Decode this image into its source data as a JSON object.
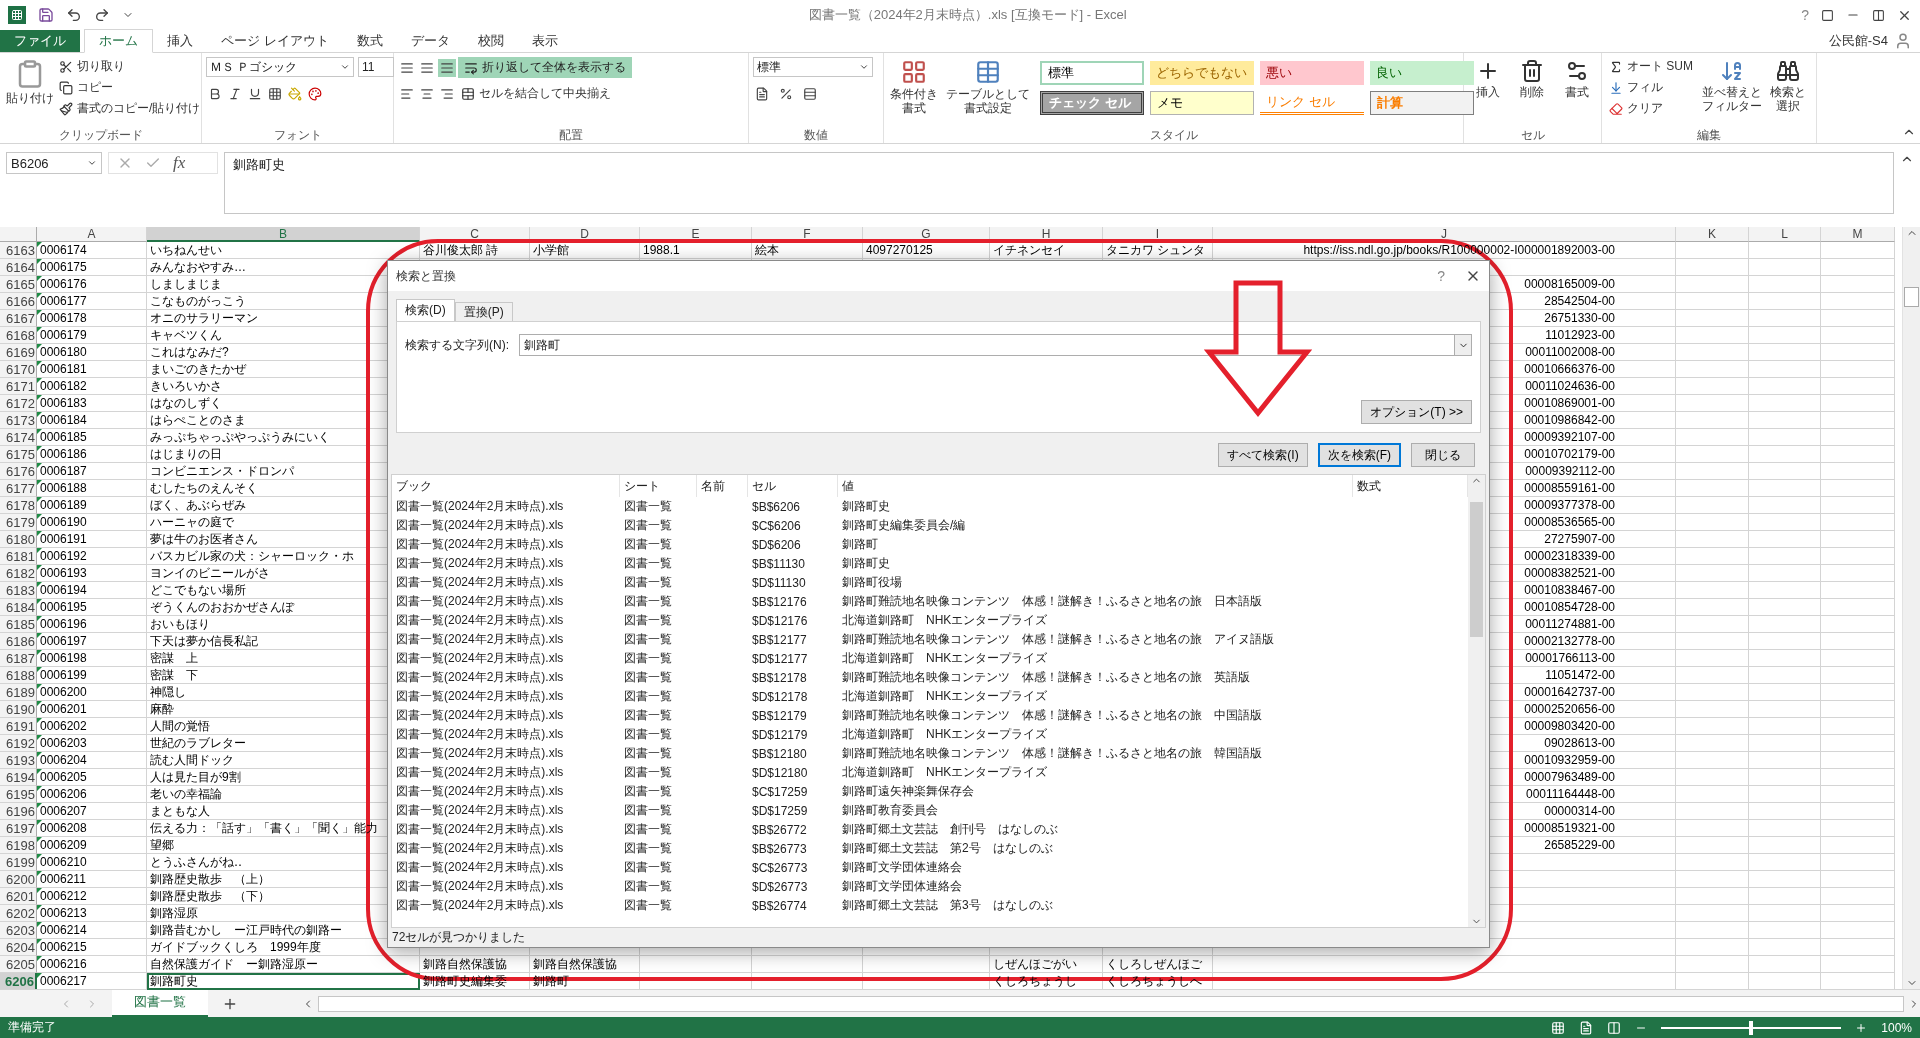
{
  "window": {
    "title": "図書一覧（2024年2月末時点）.xls  [互換モード] - Excel",
    "help": "?",
    "account": "公民館-S4"
  },
  "ribbon": {
    "tabs": [
      {
        "label": "ファイル",
        "kind": "file",
        "selected": false
      },
      {
        "label": "ホーム",
        "kind": "tab",
        "selected": true
      },
      {
        "label": "挿入",
        "kind": "tab",
        "selected": false
      },
      {
        "label": "ページ レイアウト",
        "kind": "tab",
        "selected": false
      },
      {
        "label": "数式",
        "kind": "tab",
        "selected": false
      },
      {
        "label": "データ",
        "kind": "tab",
        "selected": false
      },
      {
        "label": "校閲",
        "kind": "tab",
        "selected": false
      },
      {
        "label": "表示",
        "kind": "tab",
        "selected": false
      }
    ],
    "clipboard": {
      "label": "クリップボード",
      "paste": "貼り付け",
      "cut": "切り取り",
      "copy": "コピー",
      "format_painter": "書式のコピー/貼り付け"
    },
    "font": {
      "label": "フォント",
      "name": "ＭＳ Ｐゴシック",
      "size": "11"
    },
    "alignment": {
      "label": "配置",
      "wrap_text": {
        "label": "折り返して全体を表示する",
        "selected": true
      },
      "merge": "セルを結合して中央揃え"
    },
    "number": {
      "label": "数値",
      "format": "標準"
    },
    "styles": {
      "label": "スタイル",
      "conditional": [
        "条件付き",
        "書式"
      ],
      "table": [
        "テーブルとして",
        "書式設定"
      ],
      "gallery": [
        {
          "label": "標準",
          "kind": "normal"
        },
        {
          "label": "どちらでもない",
          "kind": "neutral"
        },
        {
          "label": "悪い",
          "kind": "bad"
        },
        {
          "label": "良い",
          "kind": "good"
        },
        {
          "label": "チェック セル",
          "kind": "check"
        },
        {
          "label": "メモ",
          "kind": "note"
        },
        {
          "label": "リンク セル",
          "kind": "link"
        },
        {
          "label": "計算",
          "kind": "calc"
        }
      ]
    },
    "cells": {
      "label": "セル",
      "insert": "挿入",
      "delete": "削除",
      "format": "書式"
    },
    "editing": {
      "label": "編集",
      "autosum": "オート SUM",
      "fill": "フィル",
      "clear": "クリア",
      "sort": [
        "並べ替えと",
        "フィルター"
      ],
      "find": [
        "検索と",
        "選択"
      ]
    }
  },
  "formula_bar": {
    "name_box": "B6206",
    "fx": "fx",
    "value": "釧路町史"
  },
  "sheet": {
    "columns": [
      {
        "label": "A",
        "selected": false
      },
      {
        "label": "B",
        "selected": true
      },
      {
        "label": "C",
        "selected": false
      },
      {
        "label": "D",
        "selected": false
      },
      {
        "label": "E",
        "selected": false
      },
      {
        "label": "F",
        "selected": false
      },
      {
        "label": "G",
        "selected": false
      },
      {
        "label": "H",
        "selected": false
      },
      {
        "label": "I",
        "selected": false
      },
      {
        "label": "J",
        "selected": false
      },
      {
        "label": "K",
        "selected": false
      },
      {
        "label": "L",
        "selected": false
      },
      {
        "label": "M",
        "selected": false
      }
    ],
    "rows": [
      {
        "number": "6163",
        "selected": false,
        "cells": {
          "A": "0006174",
          "B": "いちねんせい",
          "C": "谷川俊太郎 詩",
          "D": "小学館",
          "E": "1988.1",
          "F": "絵本",
          "G": "4097270125",
          "H": "イチネンセイ",
          "I": "タニカワ シュンタ",
          "J": "https://iss.ndl.go.jp/books/R100000002-I000001892003-00"
        }
      },
      {
        "number": "6164",
        "selected": false,
        "cells": {
          "A": "0006175",
          "B": "みんなおやすみ…"
        }
      },
      {
        "number": "6165",
        "selected": false,
        "cells": {
          "A": "0006176",
          "B": "しましまじま",
          "J": "00008165009-00"
        }
      },
      {
        "number": "6166",
        "selected": false,
        "cells": {
          "A": "0006177",
          "B": "こなものがっこう",
          "J": "28542504-00"
        }
      },
      {
        "number": "6167",
        "selected": false,
        "cells": {
          "A": "0006178",
          "B": "オニのサラリーマン",
          "J": "26751330-00"
        }
      },
      {
        "number": "6168",
        "selected": false,
        "cells": {
          "A": "0006179",
          "B": "キャベツくん",
          "J": "11012923-00"
        }
      },
      {
        "number": "6169",
        "selected": false,
        "cells": {
          "A": "0006180",
          "B": "これはなみだ?",
          "J": "00011002008-00"
        }
      },
      {
        "number": "6170",
        "selected": false,
        "cells": {
          "A": "0006181",
          "B": "まいごのきたかぜ",
          "J": "00010666376-00"
        }
      },
      {
        "number": "6171",
        "selected": false,
        "cells": {
          "A": "0006182",
          "B": "きいろいかさ",
          "J": "00011024636-00"
        }
      },
      {
        "number": "6172",
        "selected": false,
        "cells": {
          "A": "0006183",
          "B": "はなのしずく",
          "J": "00010869001-00"
        }
      },
      {
        "number": "6173",
        "selected": false,
        "cells": {
          "A": "0006184",
          "B": "はらぺことのさま",
          "J": "00010986842-00"
        }
      },
      {
        "number": "6174",
        "selected": false,
        "cells": {
          "A": "0006185",
          "B": "みっぷちゃっぷやっぷうみにいく",
          "J": "00009392107-00"
        }
      },
      {
        "number": "6175",
        "selected": false,
        "cells": {
          "A": "0006186",
          "B": "はじまりの日",
          "J": "00010702179-00"
        }
      },
      {
        "number": "6176",
        "selected": false,
        "cells": {
          "A": "0006187",
          "B": "コンビニエンス・ドロンパ",
          "J": "00009392112-00"
        }
      },
      {
        "number": "6177",
        "selected": false,
        "cells": {
          "A": "0006188",
          "B": "むしたちのえんそく",
          "J": "00008559161-00"
        }
      },
      {
        "number": "6178",
        "selected": false,
        "cells": {
          "A": "0006189",
          "B": "ぼく、あぶらぜみ",
          "J": "00009377378-00"
        }
      },
      {
        "number": "6179",
        "selected": false,
        "cells": {
          "A": "0006190",
          "B": "ハーニャの庭で",
          "J": "00008536565-00"
        }
      },
      {
        "number": "6180",
        "selected": false,
        "cells": {
          "A": "0006191",
          "B": "夢は牛のお医者さん",
          "J": "27275907-00"
        }
      },
      {
        "number": "6181",
        "selected": false,
        "cells": {
          "A": "0006192",
          "B": "バスカビル家の犬：シャーロック・ホ",
          "J": "00002318339-00"
        }
      },
      {
        "number": "6182",
        "selected": false,
        "cells": {
          "A": "0006193",
          "B": "ヨンイのビニールがさ",
          "J": "00008382521-00"
        }
      },
      {
        "number": "6183",
        "selected": false,
        "cells": {
          "A": "0006194",
          "B": "どこでもない場所",
          "J": "00010838467-00"
        }
      },
      {
        "number": "6184",
        "selected": false,
        "cells": {
          "A": "0006195",
          "B": "ぞうくんのおおかぜさんぽ",
          "J": "00010854728-00"
        }
      },
      {
        "number": "6185",
        "selected": false,
        "cells": {
          "A": "0006196",
          "B": "おいもほり",
          "J": "00011274881-00"
        }
      },
      {
        "number": "6186",
        "selected": false,
        "cells": {
          "A": "0006197",
          "B": "下天は夢か信長私記",
          "J": "00002132778-00"
        }
      },
      {
        "number": "6187",
        "selected": false,
        "cells": {
          "A": "0006198",
          "B": "密謀　上",
          "J": "00001766113-00"
        }
      },
      {
        "number": "6188",
        "selected": false,
        "cells": {
          "A": "0006199",
          "B": "密謀　下",
          "J": "11051472-00"
        }
      },
      {
        "number": "6189",
        "selected": false,
        "cells": {
          "A": "0006200",
          "B": "神隠し",
          "J": "00001642737-00"
        }
      },
      {
        "number": "6190",
        "selected": false,
        "cells": {
          "A": "0006201",
          "B": "麻酔",
          "J": "00002520656-00"
        }
      },
      {
        "number": "6191",
        "selected": false,
        "cells": {
          "A": "0006202",
          "B": "人間の覚悟",
          "J": "00009803420-00"
        }
      },
      {
        "number": "6192",
        "selected": false,
        "cells": {
          "A": "0006203",
          "B": "世紀のラブレター",
          "J": "09028613-00"
        }
      },
      {
        "number": "6193",
        "selected": false,
        "cells": {
          "A": "0006204",
          "B": "読む人間ドック",
          "J": "00010932959-00"
        }
      },
      {
        "number": "6194",
        "selected": false,
        "cells": {
          "A": "0006205",
          "B": "人は見た目が9割",
          "J": "00007963489-00"
        }
      },
      {
        "number": "6195",
        "selected": false,
        "cells": {
          "A": "0006206",
          "B": "老いの幸福論",
          "J": "00011164448-00"
        }
      },
      {
        "number": "6196",
        "selected": false,
        "cells": {
          "A": "0006207",
          "B": "まともな人",
          "J": "00000314-00"
        }
      },
      {
        "number": "6197",
        "selected": false,
        "cells": {
          "A": "0006208",
          "B": "伝える力：「話す」「書く」「聞く」能力",
          "J": "00008519321-00"
        }
      },
      {
        "number": "6198",
        "selected": false,
        "cells": {
          "A": "0006209",
          "B": "望郷",
          "J": "26585229-00"
        }
      },
      {
        "number": "6199",
        "selected": false,
        "cells": {
          "A": "0006210",
          "B": "とうふさんがね‥"
        }
      },
      {
        "number": "6200",
        "selected": false,
        "cells": {
          "A": "0006211",
          "B": "釧路歴史散歩　（上）"
        }
      },
      {
        "number": "6201",
        "selected": false,
        "cells": {
          "A": "0006212",
          "B": "釧路歴史散歩　（下）"
        }
      },
      {
        "number": "6202",
        "selected": false,
        "cells": {
          "A": "0006213",
          "B": "釧路湿原"
        }
      },
      {
        "number": "6203",
        "selected": false,
        "cells": {
          "A": "0006214",
          "B": "釧路昔むかし　ー江戸時代の釧路ー"
        }
      },
      {
        "number": "6204",
        "selected": false,
        "cells": {
          "A": "0006215",
          "B": "ガイドブックくしろ　1999年度"
        }
      },
      {
        "number": "6205",
        "selected": false,
        "cells": {
          "A": "0006216",
          "B": "自然保護ガイド　ー釧路湿原ー",
          "C": "釧路自然保護協",
          "D": "釧路自然保護協",
          "H": "しぜんほごがい",
          "I": "くしろしぜんほご"
        }
      },
      {
        "number": "6206",
        "selected": true,
        "cells": {
          "A": "0006217",
          "B": "釧路町史",
          "C": "釧路町史編集委",
          "D": "釧路町",
          "H": "くしろちょうし",
          "I": "くしろちょうしへ"
        }
      }
    ]
  },
  "dialog": {
    "title": "検索と置換",
    "help": "?",
    "tabs": [
      {
        "label": "検索(D)",
        "selected": true
      },
      {
        "label": "置換(P)",
        "selected": false
      }
    ],
    "search_label": "検索する文字列(N):",
    "search_value": "釧路町",
    "options_button": "オプション(T) >>",
    "buttons": [
      {
        "label": "すべて検索(I)",
        "selected": false
      },
      {
        "label": "次を検索(F)",
        "selected": true
      },
      {
        "label": "閉じる",
        "selected": false
      }
    ],
    "results": {
      "columns": [
        "ブック",
        "シート",
        "名前",
        "セル",
        "値",
        "数式"
      ],
      "rows": [
        {
          "book": "図書一覧(2024年2月末時点).xls",
          "sheet": "図書一覧",
          "cell": "$B$6206",
          "value": "釧路町史"
        },
        {
          "book": "図書一覧(2024年2月末時点).xls",
          "sheet": "図書一覧",
          "cell": "$C$6206",
          "value": "釧路町史編集委員会/編"
        },
        {
          "book": "図書一覧(2024年2月末時点).xls",
          "sheet": "図書一覧",
          "cell": "$D$6206",
          "value": "釧路町"
        },
        {
          "book": "図書一覧(2024年2月末時点).xls",
          "sheet": "図書一覧",
          "cell": "$B$11130",
          "value": "釧路町史"
        },
        {
          "book": "図書一覧(2024年2月末時点).xls",
          "sheet": "図書一覧",
          "cell": "$D$11130",
          "value": "釧路町役場"
        },
        {
          "book": "図書一覧(2024年2月末時点).xls",
          "sheet": "図書一覧",
          "cell": "$B$12176",
          "value": "釧路町難読地名映像コンテンツ　体感！謎解き！ふるさと地名の旅　日本語版"
        },
        {
          "book": "図書一覧(2024年2月末時点).xls",
          "sheet": "図書一覧",
          "cell": "$D$12176",
          "value": "北海道釧路町　NHKエンタープライズ"
        },
        {
          "book": "図書一覧(2024年2月末時点).xls",
          "sheet": "図書一覧",
          "cell": "$B$12177",
          "value": "釧路町難読地名映像コンテンツ　体感！謎解き！ふるさと地名の旅　アイヌ語版"
        },
        {
          "book": "図書一覧(2024年2月末時点).xls",
          "sheet": "図書一覧",
          "cell": "$D$12177",
          "value": "北海道釧路町　NHKエンタープライズ"
        },
        {
          "book": "図書一覧(2024年2月末時点).xls",
          "sheet": "図書一覧",
          "cell": "$B$12178",
          "value": "釧路町難読地名映像コンテンツ　体感！謎解き！ふるさと地名の旅　英語版"
        },
        {
          "book": "図書一覧(2024年2月末時点).xls",
          "sheet": "図書一覧",
          "cell": "$D$12178",
          "value": "北海道釧路町　NHKエンタープライズ"
        },
        {
          "book": "図書一覧(2024年2月末時点).xls",
          "sheet": "図書一覧",
          "cell": "$B$12179",
          "value": "釧路町難読地名映像コンテンツ　体感！謎解き！ふるさと地名の旅　中国語版"
        },
        {
          "book": "図書一覧(2024年2月末時点).xls",
          "sheet": "図書一覧",
          "cell": "$D$12179",
          "value": "北海道釧路町　NHKエンタープライズ"
        },
        {
          "book": "図書一覧(2024年2月末時点).xls",
          "sheet": "図書一覧",
          "cell": "$B$12180",
          "value": "釧路町難読地名映像コンテンツ　体感！謎解き！ふるさと地名の旅　韓国語版"
        },
        {
          "book": "図書一覧(2024年2月末時点).xls",
          "sheet": "図書一覧",
          "cell": "$D$12180",
          "value": "北海道釧路町　NHKエンタープライズ"
        },
        {
          "book": "図書一覧(2024年2月末時点).xls",
          "sheet": "図書一覧",
          "cell": "$C$17259",
          "value": "釧路町遠矢神楽舞保存会"
        },
        {
          "book": "図書一覧(2024年2月末時点).xls",
          "sheet": "図書一覧",
          "cell": "$D$17259",
          "value": "釧路町教育委員会"
        },
        {
          "book": "図書一覧(2024年2月末時点).xls",
          "sheet": "図書一覧",
          "cell": "$B$26772",
          "value": "釧路町郷土文芸誌　創刊号　はなしのぶ"
        },
        {
          "book": "図書一覧(2024年2月末時点).xls",
          "sheet": "図書一覧",
          "cell": "$B$26773",
          "value": "釧路町郷土文芸誌　第2号　はなしのぶ"
        },
        {
          "book": "図書一覧(2024年2月末時点).xls",
          "sheet": "図書一覧",
          "cell": "$C$26773",
          "value": "釧路町文学団体連絡会"
        },
        {
          "book": "図書一覧(2024年2月末時点).xls",
          "sheet": "図書一覧",
          "cell": "$D$26773",
          "value": "釧路町文学団体連絡会"
        },
        {
          "book": "図書一覧(2024年2月末時点).xls",
          "sheet": "図書一覧",
          "cell": "$B$26774",
          "value": "釧路町郷土文芸誌　第3号　はなしのぶ"
        }
      ]
    },
    "status": "72セルが見つかりました"
  },
  "sheet_tabs": [
    {
      "label": "図書一覧",
      "selected": true
    }
  ],
  "status_bar": {
    "text": "準備完了",
    "zoom": {
      "level": 0.5,
      "reading": "100%"
    }
  }
}
